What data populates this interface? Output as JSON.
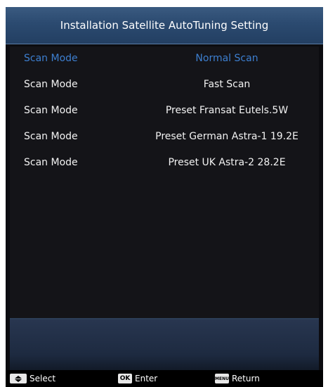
{
  "header": {
    "title": "Installation Satellite AutoTuning Setting"
  },
  "scan_modes": [
    {
      "label": "Scan Mode",
      "value": "Normal Scan",
      "selected": true
    },
    {
      "label": "Scan Mode",
      "value": "Fast Scan",
      "selected": false
    },
    {
      "label": "Scan Mode",
      "value": "Preset Fransat Eutels.5W",
      "selected": false
    },
    {
      "label": "Scan Mode",
      "value": "Preset German Astra-1 19.2E",
      "selected": false
    },
    {
      "label": "Scan Mode",
      "value": "Preset UK Astra-2 28.2E",
      "selected": false
    }
  ],
  "footer": {
    "select_label": "Select",
    "enter_key": "OK",
    "enter_label": "Enter",
    "return_key": "MENU",
    "return_label": "Return"
  },
  "colors": {
    "selected_text": "#3d7fd0",
    "title_bar": "#2b4a70",
    "background": "#0c0c10"
  }
}
